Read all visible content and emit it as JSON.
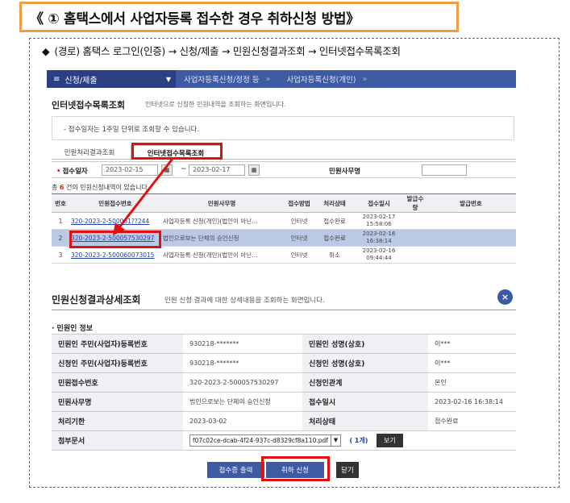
{
  "header": {
    "title": "《 ① 홈택스에서 사업자등록 접수한 경우 취하신청 방법》",
    "route": "(경로) 홈택스 로그인(인증) → 신청/제출 → 민원신청결과조회 → 인터넷접수목록조회"
  },
  "navbar": {
    "menu_label": "신청/제출",
    "crumbs": [
      "사업자등록신청/정정 등",
      "사업자등록신청(개인)"
    ]
  },
  "list_section": {
    "title": "인터넷접수목록조회",
    "desc": "인터넷으로 신청한 민원내역을 조회하는 화면입니다.",
    "notice": "- 접수일자는 1주일 단위로 조회할 수 있습니다.",
    "tabs": [
      "민원처리결과조회",
      "인터넷접수목록조회"
    ],
    "search": {
      "date_label": "접수일자",
      "date_from": "2023-02-15",
      "date_to": "2023-02-17",
      "tilde": "~",
      "type_label": "민원사무명",
      "type_value": ""
    },
    "count_prefix": "총",
    "count": "6",
    "count_suffix": "건의 민원신청내역이 있습니다.",
    "columns": [
      "번호",
      "민원접수번호",
      "민원사무명",
      "접수방법",
      "처리상태",
      "접수일시",
      "발급수량",
      "발급번호"
    ],
    "rows": [
      {
        "no": "1",
        "receipt": "320-2023-2-500061??244",
        "name": "사업자등록 신청(개인)(법인이 아닌…",
        "method": "인터넷",
        "status": "접수완료",
        "date": "2023-02-17",
        "time": "15:58:06",
        "qty": "",
        "issue_no": ""
      },
      {
        "no": "2",
        "receipt": "320-2023-2-500057530297",
        "name": "법인으로보는 단체의 승인신청",
        "method": "인터넷",
        "status": "접수완료",
        "date": "2023-02-16",
        "time": "16:38:14",
        "qty": "",
        "issue_no": ""
      },
      {
        "no": "3",
        "receipt": "320-2023-2-500060073015",
        "name": "사업자등록 신청(개인)(법인이 아닌…",
        "method": "인터넷",
        "status": "취소",
        "date": "2023-02-16",
        "time": "09:44:44",
        "qty": "",
        "issue_no": ""
      }
    ]
  },
  "detail_section": {
    "title": "민원신청결과상세조회",
    "desc": "민원 신청 결과에 대한 상세내용을 조회하는 화면입니다.",
    "close_icon": "×",
    "sub_title": "· 민원인 정보",
    "rows": [
      {
        "h1": "민원인 주민(사업자)등록번호",
        "v1": "930218-*******",
        "h2": "민원인 성명(상호)",
        "v2": "이***"
      },
      {
        "h1": "신청인 주민(사업자)등록번호",
        "v1": "930218-*******",
        "h2": "신청인 성명(상호)",
        "v2": "이***"
      },
      {
        "h1": "민원접수번호",
        "v1": "320-2023-2-500057530297",
        "h2": "신청인관계",
        "v2": "본인"
      },
      {
        "h1": "민원사무명",
        "v1": "법인으로보는 단체의 승인신청",
        "h2": "접수일시",
        "v2": "2023-02-16 16:38:14"
      },
      {
        "h1": "처리기한",
        "v1": "2023-03-02",
        "h2": "처리상태",
        "v2": "접수완료"
      }
    ],
    "attach_label": "첨부문서",
    "attach_file": "f07c02ce-dcab-4f24-937c-d8329cf8a110.pdf",
    "attach_count": "( 1개)",
    "view_button": "보기"
  },
  "buttons": {
    "receipt": "접수증 출력",
    "cancel": "취하 신청",
    "close": "닫기"
  },
  "colors": {
    "accent": "#3d5aa3",
    "highlight": "#e01010",
    "title_border": "#f39c45",
    "selected_row": "#b9c9e6"
  }
}
